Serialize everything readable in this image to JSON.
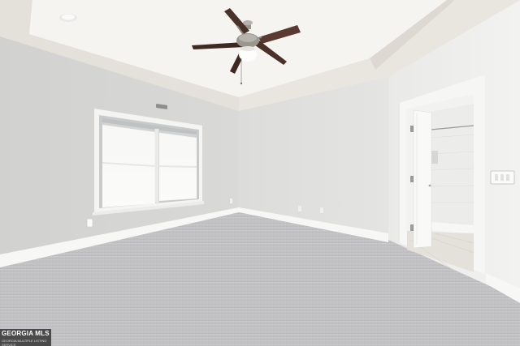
{
  "photo": {
    "subject": "empty-bedroom",
    "colors": {
      "wall_left": "#d6d6d4",
      "wall_back": "#e2e2e0",
      "wall_right": "#ececea",
      "ceiling": "#f1f0ed",
      "tray_edge": "#e5e2dc",
      "carpet": "#c4c4c6",
      "baseboard": "#f7f7f5",
      "window_glass": "#f9f9f8",
      "fan_blade": "#4a3129",
      "fan_metal": "#9a9690"
    }
  },
  "watermark": {
    "brand": "GEORGIA MLS",
    "tagline": "GEORGIA MULTIPLE LISTING SERVICE"
  }
}
